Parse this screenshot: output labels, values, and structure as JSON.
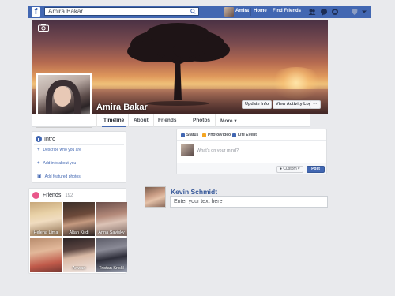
{
  "topbar": {
    "logo": "f",
    "search_value": "Amira Bakar",
    "user_name": "Amira",
    "links": [
      "Home",
      "Find Friends"
    ],
    "icons": [
      "friend-requests-icon",
      "messages-icon",
      "notifications-icon",
      "privacy-icon",
      "account-menu-icon"
    ]
  },
  "profile": {
    "name": "Amira Bakar",
    "buttons": {
      "update_info": "Update Info",
      "activity_log": "View Activity Log",
      "more": "···"
    }
  },
  "nav": {
    "tabs": [
      "Timeline",
      "About",
      "Friends",
      "Photos",
      "More ▾"
    ],
    "active": "Timeline"
  },
  "intro": {
    "title": "Intro",
    "links": [
      "Describe who you are",
      "Add info about you",
      "Add featured photos"
    ]
  },
  "friends": {
    "title": "Friends",
    "count": "192",
    "items": [
      {
        "name": "Helena Lima"
      },
      {
        "name": "Altan Kirdi"
      },
      {
        "name": "Anna Sayisky"
      },
      {
        "name": ""
      },
      {
        "name": "Anwan"
      },
      {
        "name": "Tristan Kriskl"
      }
    ]
  },
  "composer": {
    "tabs": [
      "Status",
      "Photo/Video",
      "Life Event"
    ],
    "placeholder": "What's on your mind?",
    "audience": "Custom ▾",
    "post_label": "Post"
  },
  "comment": {
    "name": "Kevin Schmidt",
    "placeholder": "Enter your text here"
  },
  "colors": {
    "brand": "#4267b2",
    "link": "#365899",
    "background": "#e9eaed"
  }
}
